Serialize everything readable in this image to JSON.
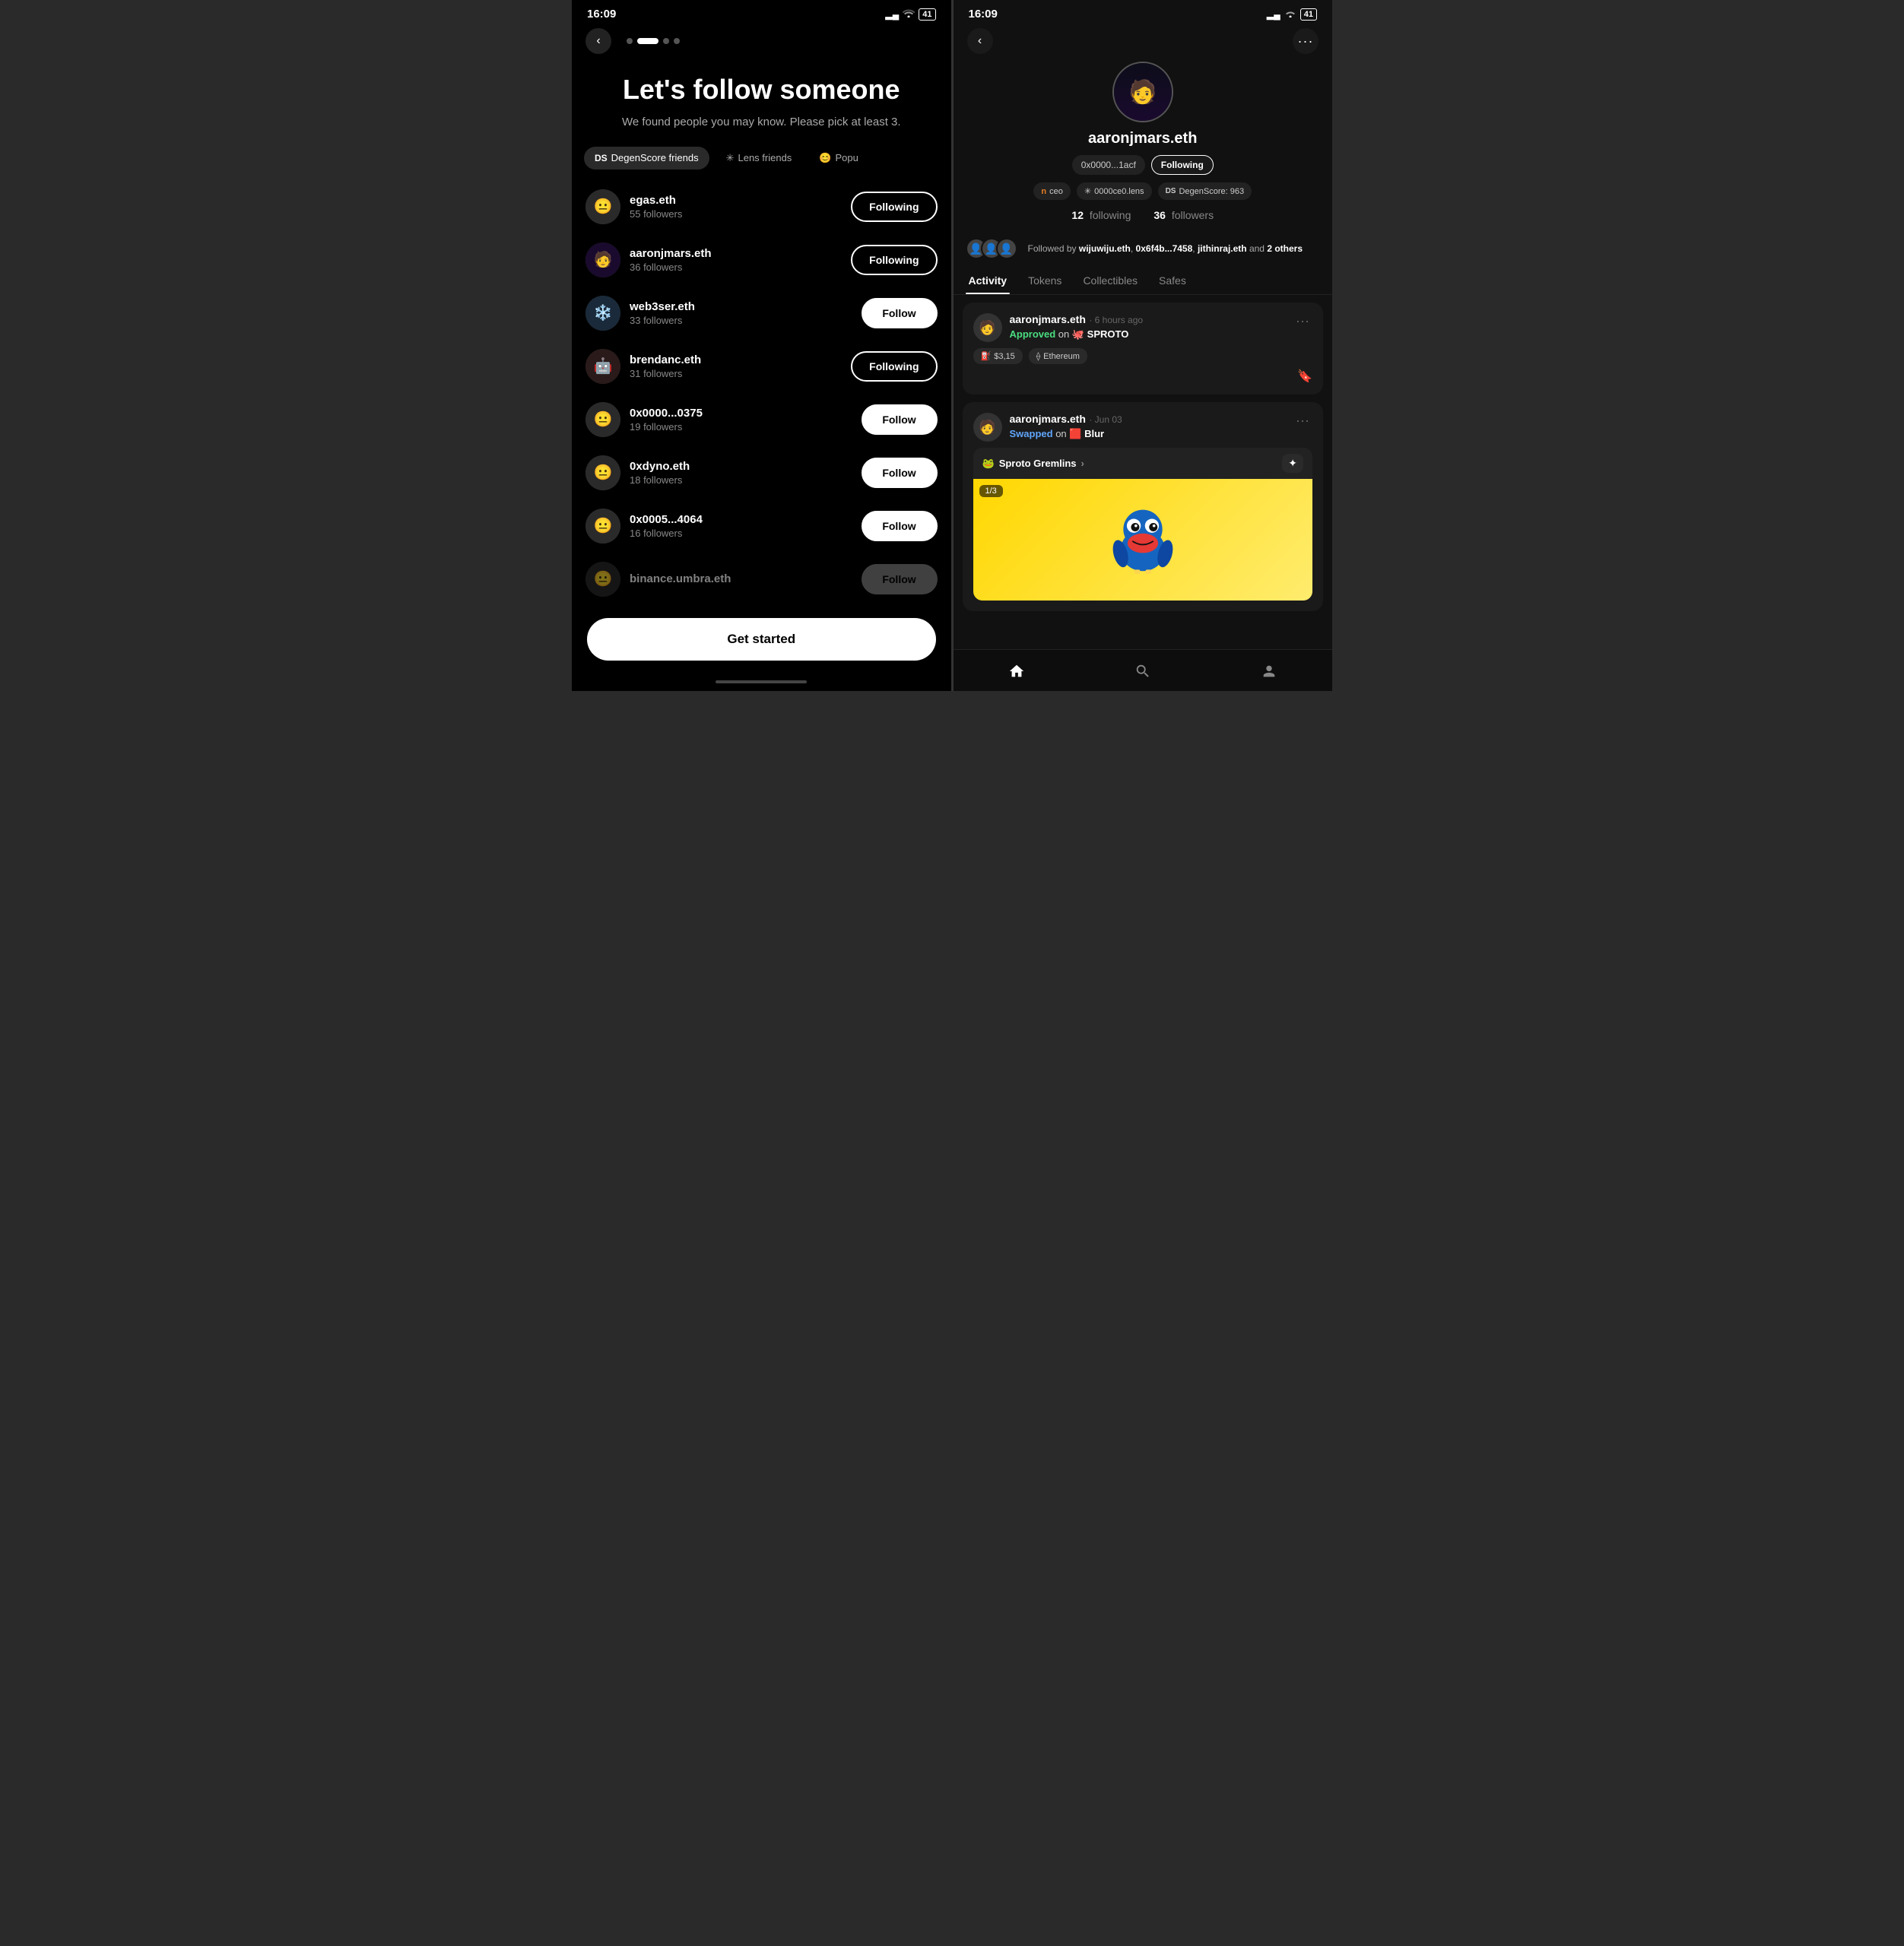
{
  "left_phone": {
    "status_bar": {
      "time": "16:09",
      "signal": "▂▄",
      "wifi": "WiFi",
      "battery": "41"
    },
    "hero": {
      "title": "Let's follow someone",
      "subtitle": "We found people you may know. Please pick at least 3."
    },
    "filter_tabs": [
      {
        "id": "degenscore",
        "label": "DegenScore friends",
        "active": true
      },
      {
        "id": "lens",
        "label": "Lens friends",
        "active": false
      },
      {
        "id": "popular",
        "label": "Popu",
        "active": false
      }
    ],
    "users": [
      {
        "name": "egas.eth",
        "followers": "55 followers",
        "status": "Following",
        "avatar": "😐"
      },
      {
        "name": "aaronjmars.eth",
        "followers": "36 followers",
        "status": "Following",
        "avatar": "🧑"
      },
      {
        "name": "web3ser.eth",
        "followers": "33 followers",
        "status": "Follow",
        "avatar": "🧊"
      },
      {
        "name": "brendanc.eth",
        "followers": "31 followers",
        "status": "Following",
        "avatar": "🤖"
      },
      {
        "name": "0x0000...0375",
        "followers": "19 followers",
        "status": "Follow",
        "avatar": "😐"
      },
      {
        "name": "0xdyno.eth",
        "followers": "18 followers",
        "status": "Follow",
        "avatar": "😐"
      },
      {
        "name": "0x0005...4064",
        "followers": "16 followers",
        "status": "Follow",
        "avatar": "😐"
      },
      {
        "name": "binance.umbra.eth",
        "followers": "",
        "status": "Follow",
        "avatar": "😐"
      }
    ],
    "get_started": "Get started"
  },
  "right_phone": {
    "status_bar": {
      "time": "16:09",
      "signal": "▂▄",
      "wifi": "WiFi",
      "battery": "41"
    },
    "profile": {
      "name": "aaronjmars.eth",
      "address": "0x0000...1acf",
      "following_status": "Following",
      "badges": [
        {
          "label": "ceo",
          "icon": "n"
        },
        {
          "label": "0000ce0.lens",
          "icon": "✳"
        },
        {
          "label": "DegenScore: 963",
          "icon": "DS"
        }
      ],
      "stats": {
        "following": "12",
        "following_label": "following",
        "followers": "36",
        "followers_label": "followers"
      },
      "followed_by": "Followed by wijuwiju.eth, 0x6f4b...7458, jithinraj.eth and 2 others"
    },
    "tabs": [
      "Activity",
      "Tokens",
      "Collectibles",
      "Safes"
    ],
    "active_tab": "Activity",
    "activity": [
      {
        "user": "aaronjmars.eth",
        "time": "6 hours ago",
        "action_type": "Approved",
        "action_text": "on",
        "platform": "SPROTO",
        "chips": [
          "$3,15",
          "Ethereum"
        ],
        "has_bookmark": true
      },
      {
        "user": "aaronjmars.eth",
        "time": "Jun 03",
        "action_type": "Swapped",
        "action_text": "on",
        "platform": "Blur",
        "nft": {
          "title": "Sproto Gremlins",
          "badge": "1/3"
        }
      }
    ],
    "bottom_nav": [
      "home",
      "search",
      "profile"
    ]
  }
}
